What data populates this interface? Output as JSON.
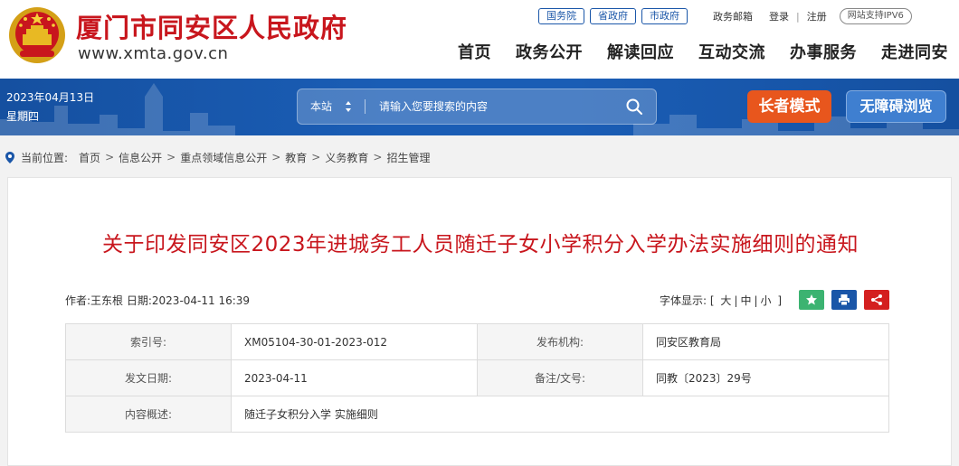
{
  "header": {
    "site_name": "厦门市同安区人民政府",
    "site_url": "www.xmta.gov.cn",
    "top_links": [
      "国务院",
      "省政府",
      "市政府"
    ],
    "mail": "政务邮箱",
    "login": "登录",
    "register": "注册",
    "ipv6": "网站支持IPV6",
    "nav": [
      "首页",
      "政务公开",
      "解读回应",
      "互动交流",
      "办事服务",
      "走进同安"
    ]
  },
  "bar": {
    "date": "2023年04月13日",
    "weekday": "星期四",
    "search_scope": "本站",
    "search_placeholder": "请输入您要搜索的内容",
    "elder_mode": "长者模式",
    "accessible": "无障碍浏览"
  },
  "breadcrumb": {
    "label": "当前位置:",
    "items": [
      "首页",
      "信息公开",
      "重点领域信息公开",
      "教育",
      "义务教育",
      "招生管理"
    ]
  },
  "article": {
    "title": "关于印发同安区2023年进城务工人员随迁子女小学积分入学办法实施细则的通知",
    "meta": "作者:王东根 日期:2023-04-11 16:39",
    "font_label": "字体显示:",
    "font_sizes": [
      "大",
      "中",
      "小"
    ],
    "info": [
      {
        "k1": "索引号:",
        "v1": "XM05104-30-01-2023-012",
        "k2": "发布机构:",
        "v2": "同安区教育局"
      },
      {
        "k1": "发文日期:",
        "v1": "2023-04-11",
        "k2": "备注/文号:",
        "v2": "同教〔2023〕29号"
      },
      {
        "k1": "内容概述:",
        "v1": "随迁子女积分入学 实施细则"
      }
    ]
  },
  "colors": {
    "brand_red": "#c8161d",
    "bar_blue": "#1a5db5",
    "elder_orange": "#e8561d",
    "star_green": "#3cb371",
    "print_blue": "#1a56a8",
    "share_red": "#d42020"
  },
  "icons": [
    "national-emblem",
    "updown-arrows-icon",
    "search-icon",
    "location-pin-icon",
    "star-icon",
    "print-icon",
    "share-icon"
  ]
}
